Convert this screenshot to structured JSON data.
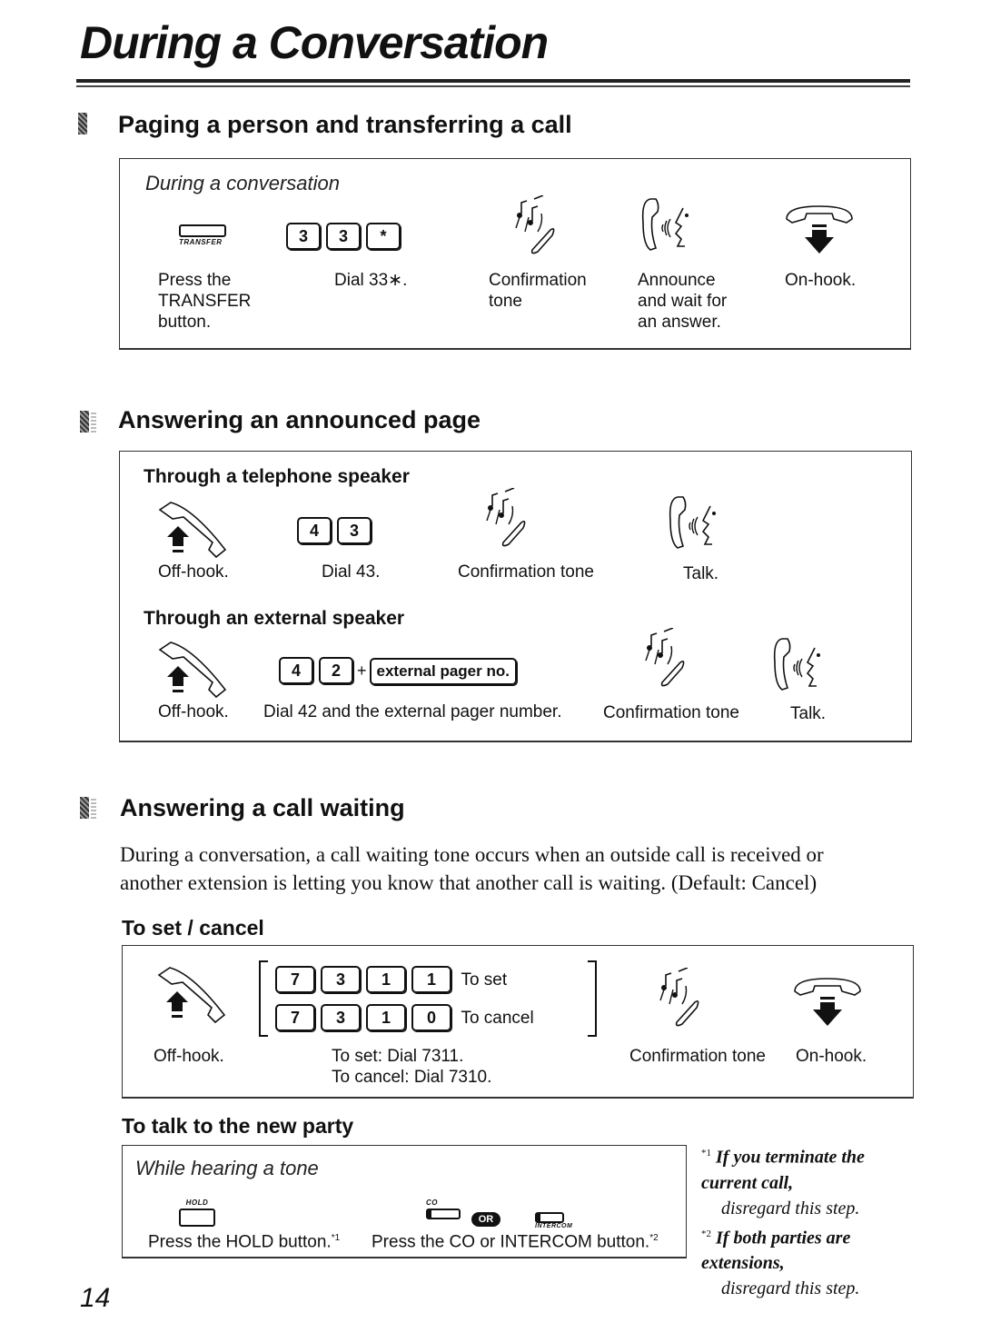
{
  "page": {
    "title": "During a Conversation",
    "page_number": "14"
  },
  "paging": {
    "heading": "Paging a person and transferring a call",
    "context": "During a conversation",
    "transfer_button_label": "TRANSFER",
    "keys": [
      "3",
      "3",
      "*"
    ],
    "steps": [
      {
        "icon": "transfer-button-icon",
        "label_lines": [
          "Press the",
          "TRANSFER",
          "button."
        ]
      },
      {
        "icon": "dial-keys-icon",
        "label_lines": [
          "Dial 33∗."
        ]
      },
      {
        "icon": "confirmation-tone-icon",
        "label_lines": [
          "Confirmation",
          "tone"
        ]
      },
      {
        "icon": "talk-icon",
        "label_lines": [
          "Announce",
          "and wait for",
          "an answer."
        ]
      },
      {
        "icon": "on-hook-icon",
        "label_lines": [
          "On-hook."
        ]
      }
    ]
  },
  "answering_page": {
    "heading": "Answering an announced page",
    "telephone_speaker": {
      "subheading": "Through a telephone speaker",
      "keys": [
        "4",
        "3"
      ],
      "labels": [
        "Off-hook.",
        "Dial 43.",
        "Confirmation tone",
        "Talk."
      ]
    },
    "external_speaker": {
      "subheading": "Through an external speaker",
      "keys": [
        "4",
        "2"
      ],
      "plus": "+",
      "pager_key": "external pager no.",
      "labels": [
        "Off-hook.",
        "Dial 42 and the external pager number.",
        "Confirmation tone",
        "Talk."
      ]
    }
  },
  "call_waiting": {
    "heading": "Answering a call waiting",
    "description_line1": "During a conversation, a call waiting tone occurs when an outside call is received or",
    "description_line2": "another extension is letting you know that another call is waiting. (Default: Cancel)",
    "set_cancel": {
      "subheading": "To set / cancel",
      "set_keys": [
        "7",
        "3",
        "1",
        "1"
      ],
      "set_text": "To set",
      "cancel_keys": [
        "7",
        "3",
        "1",
        "0"
      ],
      "cancel_text": "To cancel",
      "labels": {
        "off_hook": "Off-hook.",
        "dial_set": "To set: Dial 7311.",
        "dial_cancel": "To cancel: Dial 7310.",
        "tone": "Confirmation tone",
        "on_hook": "On-hook."
      }
    },
    "new_party": {
      "subheading": "To talk to the new party",
      "context": "While hearing a tone",
      "hold_label": "HOLD",
      "co_label": "CO",
      "or_label": "OR",
      "intercom_label": "INTERCOM",
      "step1": "Press the HOLD button.",
      "step1_note": "*1",
      "step2": "Press the CO or INTERCOM button.",
      "step2_note": "*2"
    },
    "notes": [
      {
        "marker": "*1",
        "bold": "If you terminate the current call,",
        "rest": "disregard this step."
      },
      {
        "marker": "*2",
        "bold": "If both parties are extensions,",
        "rest": "disregard this step."
      }
    ]
  }
}
